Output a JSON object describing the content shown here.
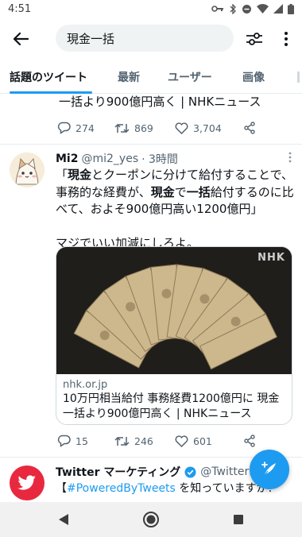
{
  "status_bar": {
    "time": "4:51"
  },
  "search": {
    "query": "現金一括"
  },
  "tabs": [
    {
      "label": "話題のツイート",
      "active": true
    },
    {
      "label": "最新",
      "active": false
    },
    {
      "label": "ユーザー",
      "active": false
    },
    {
      "label": "画像",
      "active": false
    }
  ],
  "partial_tweet": {
    "text": "一括より900億円高く | NHKニュース",
    "replies": "274",
    "retweets": "869",
    "likes": "3,704"
  },
  "tweet": {
    "name": "Mi2",
    "handle": "@mi2_yes",
    "time": "· 3時間",
    "body_line1_a": "「",
    "body_line1_b": "現金",
    "body_line1_c": "とクーポンに分けて給付することで、",
    "body_line2_a": "事務的な経費が、",
    "body_line2_b": "現金",
    "body_line2_c": "で",
    "body_line2_d": "一括",
    "body_line2_e": "給付するのに比",
    "body_line3": "べて、およそ900億円高い1200億円」",
    "body_line4": "マジでいい加減にしろよ。",
    "card_domain": "nhk.or.jp",
    "card_title": "10万円相当給付 事務経費1200億円に 現金一括より900億円高く | NHKニュース",
    "card_watermark": "NHK",
    "replies": "15",
    "retweets": "246",
    "likes": "601"
  },
  "tweet3": {
    "name": "Twitter マーケティング",
    "handle": "@TwitterM",
    "body_open": "【",
    "hashtag": "#PoweredByTweets",
    "body_rest": " を知っていますか？"
  },
  "colors": {
    "accent": "#1d9bf0",
    "text": "#0f1419",
    "secondary": "#536471",
    "twitter_avatar": "#e8283f"
  }
}
